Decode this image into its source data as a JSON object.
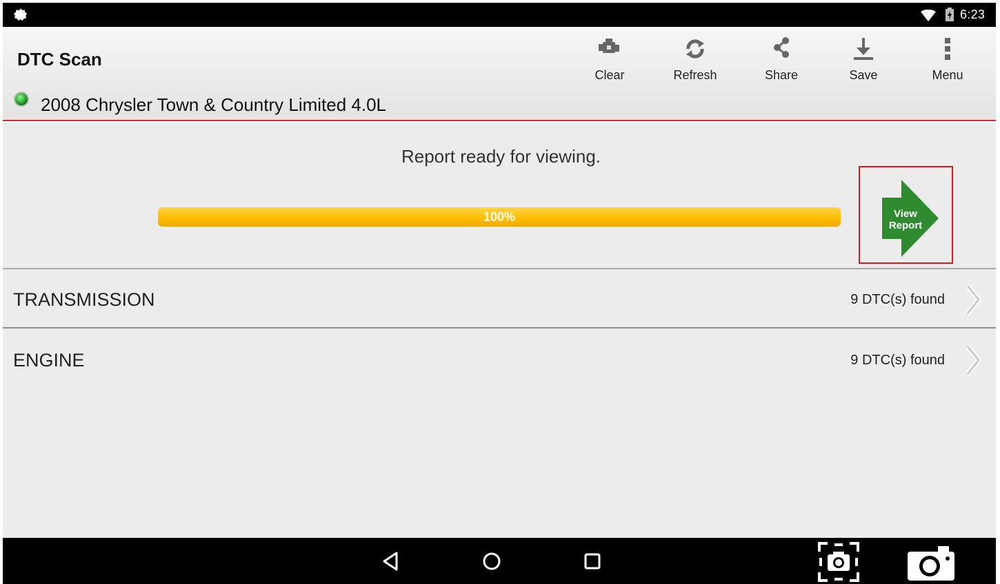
{
  "status_bar": {
    "clock": "6:23",
    "left_icon": "gear-notification-icon",
    "right_icons": [
      "wifi-icon",
      "battery-charging-icon"
    ]
  },
  "header": {
    "title": "DTC Scan",
    "vehicle": "2008 Chrysler Town & Country Limited 4.0L",
    "connection_indicator": "green-status-led-icon",
    "toolbar": {
      "clear_label": "Clear",
      "refresh_label": "Refresh",
      "share_label": "Share",
      "save_label": "Save",
      "menu_label": "Menu"
    }
  },
  "main": {
    "message": "Report ready for viewing.",
    "progress_percent": 100,
    "progress_label": "100%",
    "view_report": {
      "line1": "View",
      "line2": "Report",
      "color": "#2e8b2e",
      "highlight_border": "#e3141a"
    },
    "modules": [
      {
        "name": "TRANSMISSION",
        "status": "9 DTC(s) found"
      },
      {
        "name": "ENGINE",
        "status": "9 DTC(s) found"
      }
    ]
  },
  "nav_bar": {
    "buttons": [
      "back-icon",
      "home-icon",
      "recents-icon",
      "screenshot-icon",
      "camera-icon"
    ]
  },
  "colors": {
    "accent_red": "#d9262b",
    "progress_yellow": "#ffbf00",
    "led_green": "#2fb33a"
  }
}
